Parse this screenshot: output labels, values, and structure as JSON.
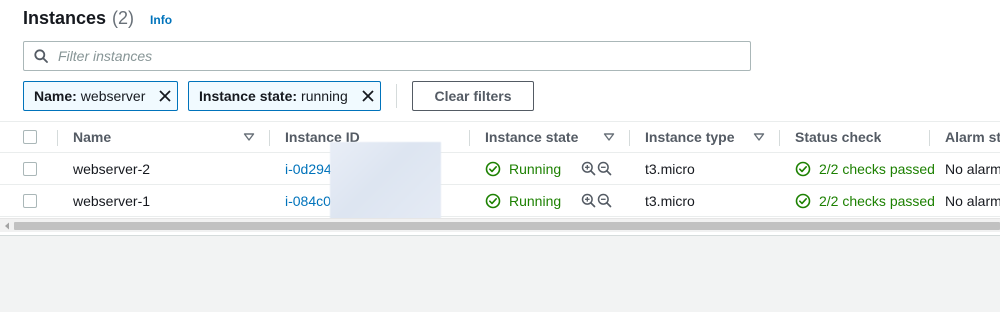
{
  "header": {
    "title": "Instances",
    "count": "(2)",
    "info_label": "Info"
  },
  "search": {
    "placeholder": "Filter instances",
    "value": ""
  },
  "filters": [
    {
      "key": "Name:",
      "value": "webserver"
    },
    {
      "key": "Instance state:",
      "value": "running"
    }
  ],
  "clear_filters_label": "Clear filters",
  "table": {
    "columns": [
      "Name",
      "Instance ID",
      "Instance state",
      "Instance type",
      "Status check",
      "Alarm st"
    ],
    "rows": [
      {
        "name": "webserver-2",
        "instance_id": "i-0d294",
        "state": "Running",
        "type": "t3.micro",
        "status_check": "2/2 checks passed",
        "alarm": "No alarm"
      },
      {
        "name": "webserver-1",
        "instance_id": "i-084c0",
        "state": "Running",
        "type": "t3.micro",
        "status_check": "2/2 checks passed",
        "alarm": "No alarm"
      }
    ]
  },
  "colors": {
    "accent": "#0073bb",
    "success": "#1d8102",
    "text": "#16191f",
    "muted": "#687078"
  }
}
